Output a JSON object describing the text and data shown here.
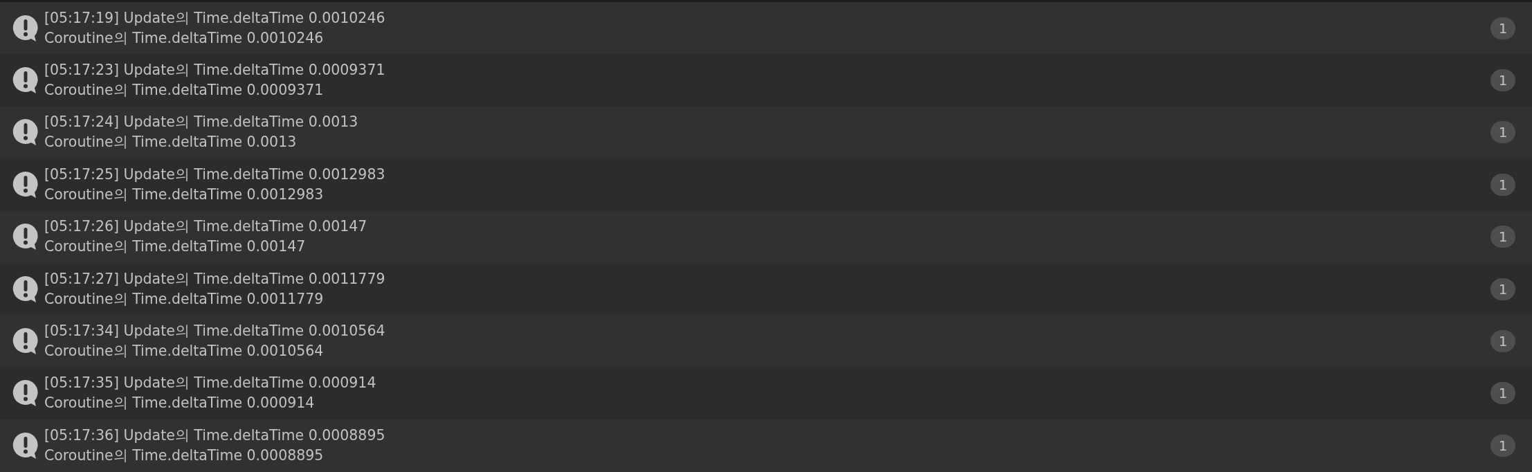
{
  "entries": [
    {
      "line_1": "[05:17:19] Update의 Time.deltaTime 0.0010246",
      "line_2": "Coroutine의 Time.deltaTime 0.0010246",
      "count": "1"
    },
    {
      "line_1": "[05:17:23] Update의 Time.deltaTime 0.0009371",
      "line_2": "Coroutine의 Time.deltaTime 0.0009371",
      "count": "1"
    },
    {
      "line_1": "[05:17:24] Update의 Time.deltaTime 0.0013",
      "line_2": "Coroutine의 Time.deltaTime 0.0013",
      "count": "1"
    },
    {
      "line_1": "[05:17:25] Update의 Time.deltaTime 0.0012983",
      "line_2": "Coroutine의 Time.deltaTime 0.0012983",
      "count": "1"
    },
    {
      "line_1": "[05:17:26] Update의 Time.deltaTime 0.00147",
      "line_2": "Coroutine의 Time.deltaTime 0.00147",
      "count": "1"
    },
    {
      "line_1": "[05:17:27] Update의 Time.deltaTime 0.0011779",
      "line_2": "Coroutine의 Time.deltaTime 0.0011779",
      "count": "1"
    },
    {
      "line_1": "[05:17:34] Update의 Time.deltaTime 0.0010564",
      "line_2": "Coroutine의 Time.deltaTime 0.0010564",
      "count": "1"
    },
    {
      "line_1": "[05:17:35] Update의 Time.deltaTime 0.000914",
      "line_2": "Coroutine의 Time.deltaTime 0.000914",
      "count": "1"
    },
    {
      "line_1": "[05:17:36] Update의 Time.deltaTime 0.0008895",
      "line_2": "Coroutine의 Time.deltaTime 0.0008895",
      "count": "1"
    }
  ]
}
